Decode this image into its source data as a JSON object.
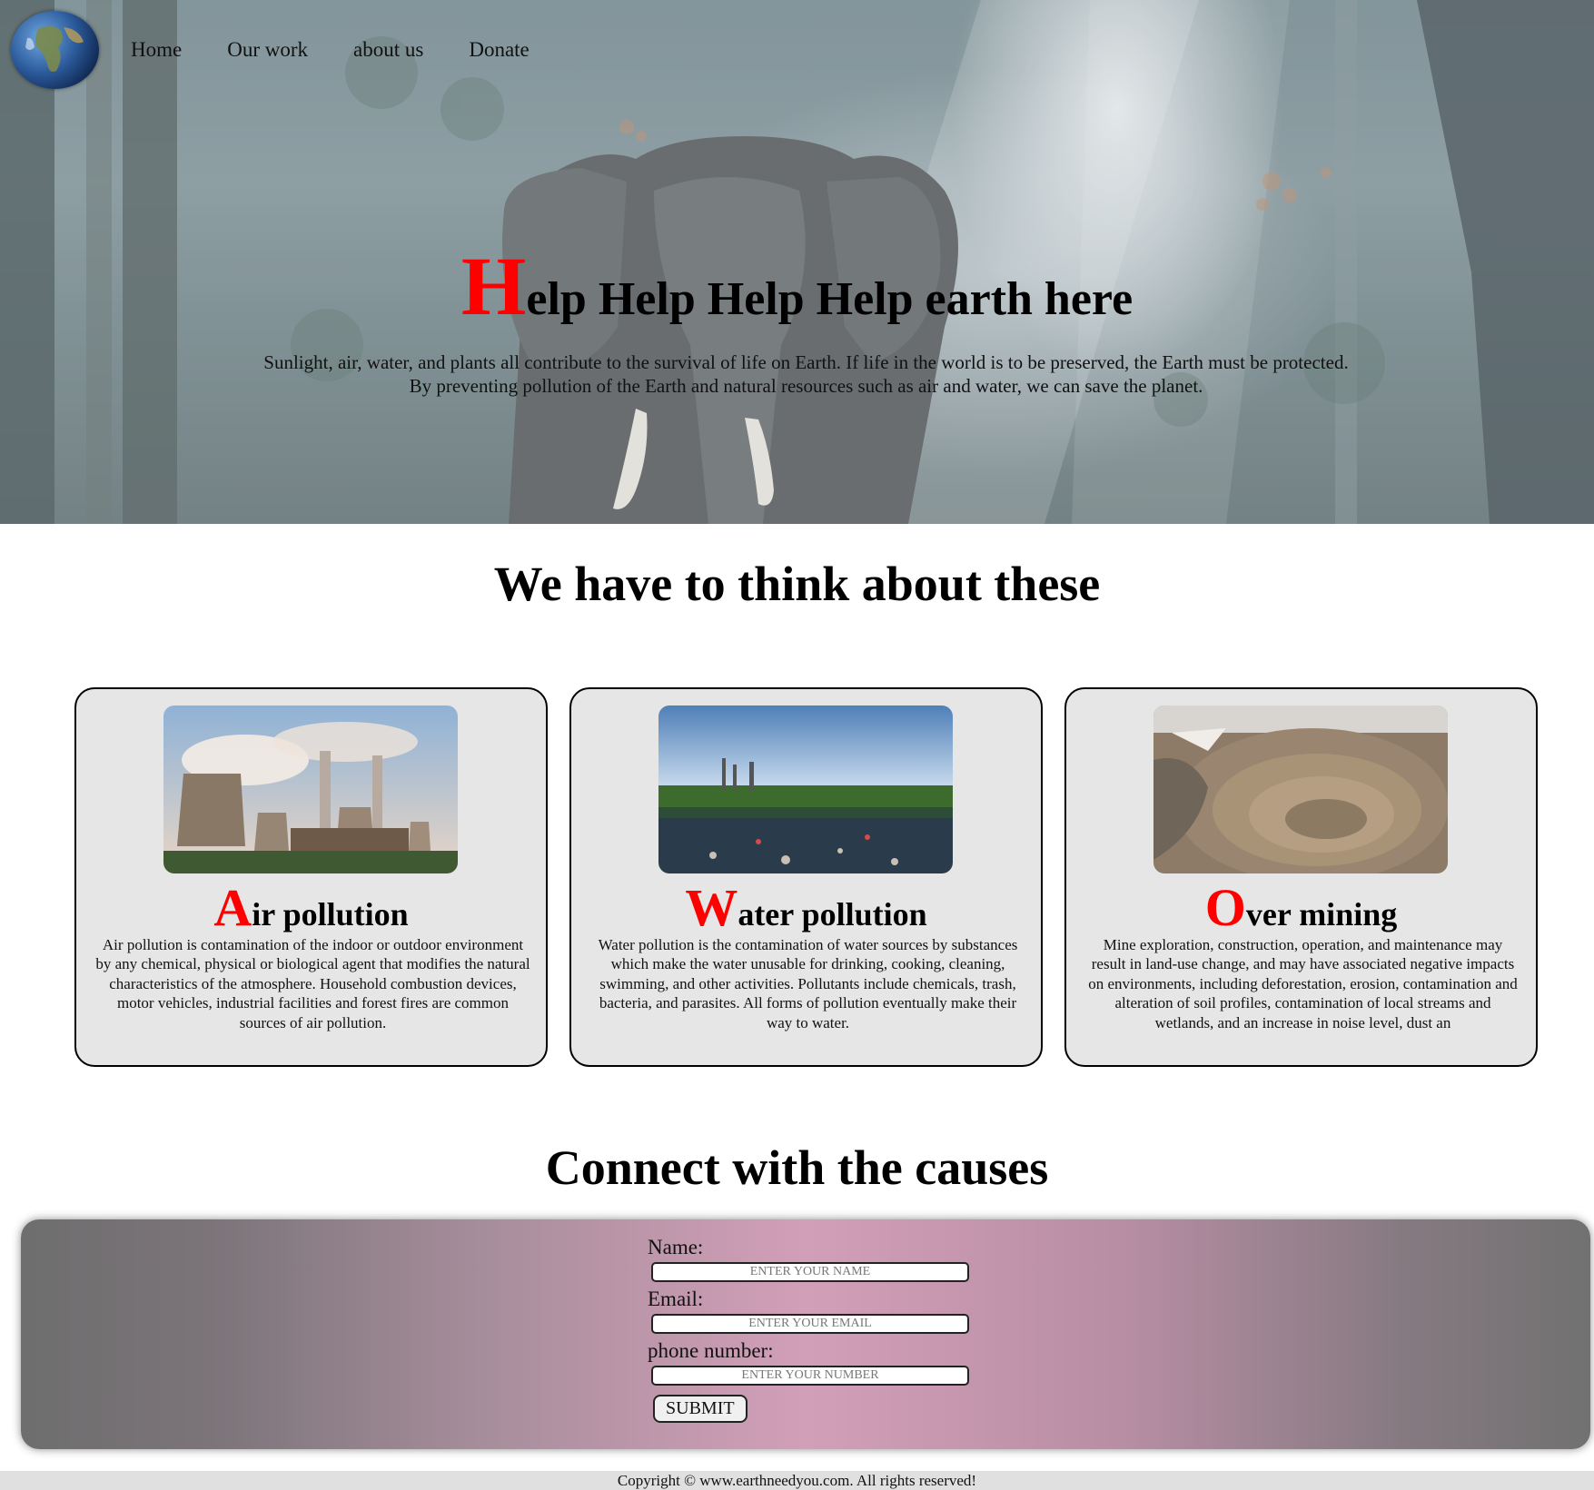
{
  "nav": {
    "logo_icon": "earth-globe-icon",
    "links": [
      "Home",
      "Our work",
      "about us",
      "Donate"
    ]
  },
  "hero": {
    "title_initial": "H",
    "title_rest": "elp Help Help Help earth here",
    "text_line1": "Sunlight, air, water, and plants all contribute to the survival of life on Earth. If life in the world is to be preserved, the Earth must be protected.",
    "text_line2": "By preventing pollution of the Earth and natural resources such as air and water, we can save the planet.",
    "background_icon": "elephant-forest-photo"
  },
  "think": {
    "title": "We have to think about these"
  },
  "cards": [
    {
      "image_icon": "power-plant-photo",
      "initial": "A",
      "title_rest": "ir pollution",
      "text": "Air pollution is contamination of the indoor or outdoor environment by any chemical, physical or biological agent that modifies the natural characteristics of the atmosphere. Household combustion devices, motor vehicles, industrial facilities and forest fires are common sources of air pollution."
    },
    {
      "image_icon": "polluted-lake-photo",
      "initial": "W",
      "title_rest": "ater pollution",
      "text": "Water pollution is the contamination of water sources by substances which make the water unusable for drinking, cooking, cleaning, swimming, and other activities. Pollutants include chemicals, trash, bacteria, and parasites. All forms of pollution eventually make their way to water."
    },
    {
      "image_icon": "open-pit-mine-photo",
      "initial": "O",
      "title_rest": "ver mining",
      "text": "Mine exploration, construction, operation, and maintenance may result in land-use change, and may have associated negative impacts on environments, including deforestation, erosion, contamination and alteration of soil profiles, contamination of local streams and wetlands, and an increase in noise level, dust an"
    }
  ],
  "connect": {
    "title": "Connect with the causes",
    "name_label": "Name:",
    "name_placeholder": "ENTER YOUR NAME",
    "email_label": "Email:",
    "email_placeholder": "ENTER YOUR EMAIL",
    "phone_label": "phone number:",
    "phone_placeholder": "ENTER YOUR NUMBER",
    "submit_label": "SUBMIT"
  },
  "footer": {
    "text": "Copyright © www.earthneedyou.com. All rights reserved!"
  },
  "colors": {
    "accent_red": "#ff0000",
    "card_bg": "#e6e6e6",
    "form_gradient_center": "#d29fb8"
  }
}
